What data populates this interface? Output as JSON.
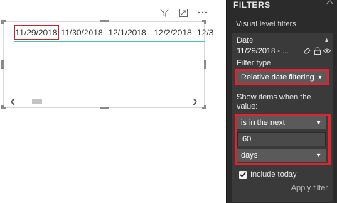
{
  "visual": {
    "dates": [
      "11/29/2018",
      "11/30/2018",
      "12/1/2018",
      "12/2/2018",
      "12/3"
    ]
  },
  "pane": {
    "title": "FILTERS",
    "section": "Visual level filters",
    "card": {
      "field": "Date",
      "summary": "11/29/2018 - ...",
      "filter_type_label": "Filter type",
      "filter_type_value": "Relative date filtering",
      "show_items_label": "Show items when the value:",
      "condition_value": "is in the next",
      "amount_value": "60",
      "unit_value": "days",
      "include_today_label": "Include today",
      "include_today_checked": true,
      "apply_label": "Apply filter"
    }
  },
  "colors": {
    "highlight": "#d0202a",
    "pane_bg": "#2b2b2b",
    "card_bg": "#3a3a3a",
    "accent_line": "#3fc7c0"
  },
  "icons": [
    "filter-icon",
    "focus-mode-icon",
    "more-options-icon",
    "eraser-icon",
    "lock-icon",
    "eye-icon",
    "chevron-up-icon",
    "chevron-down-icon",
    "checkmark-icon"
  ]
}
